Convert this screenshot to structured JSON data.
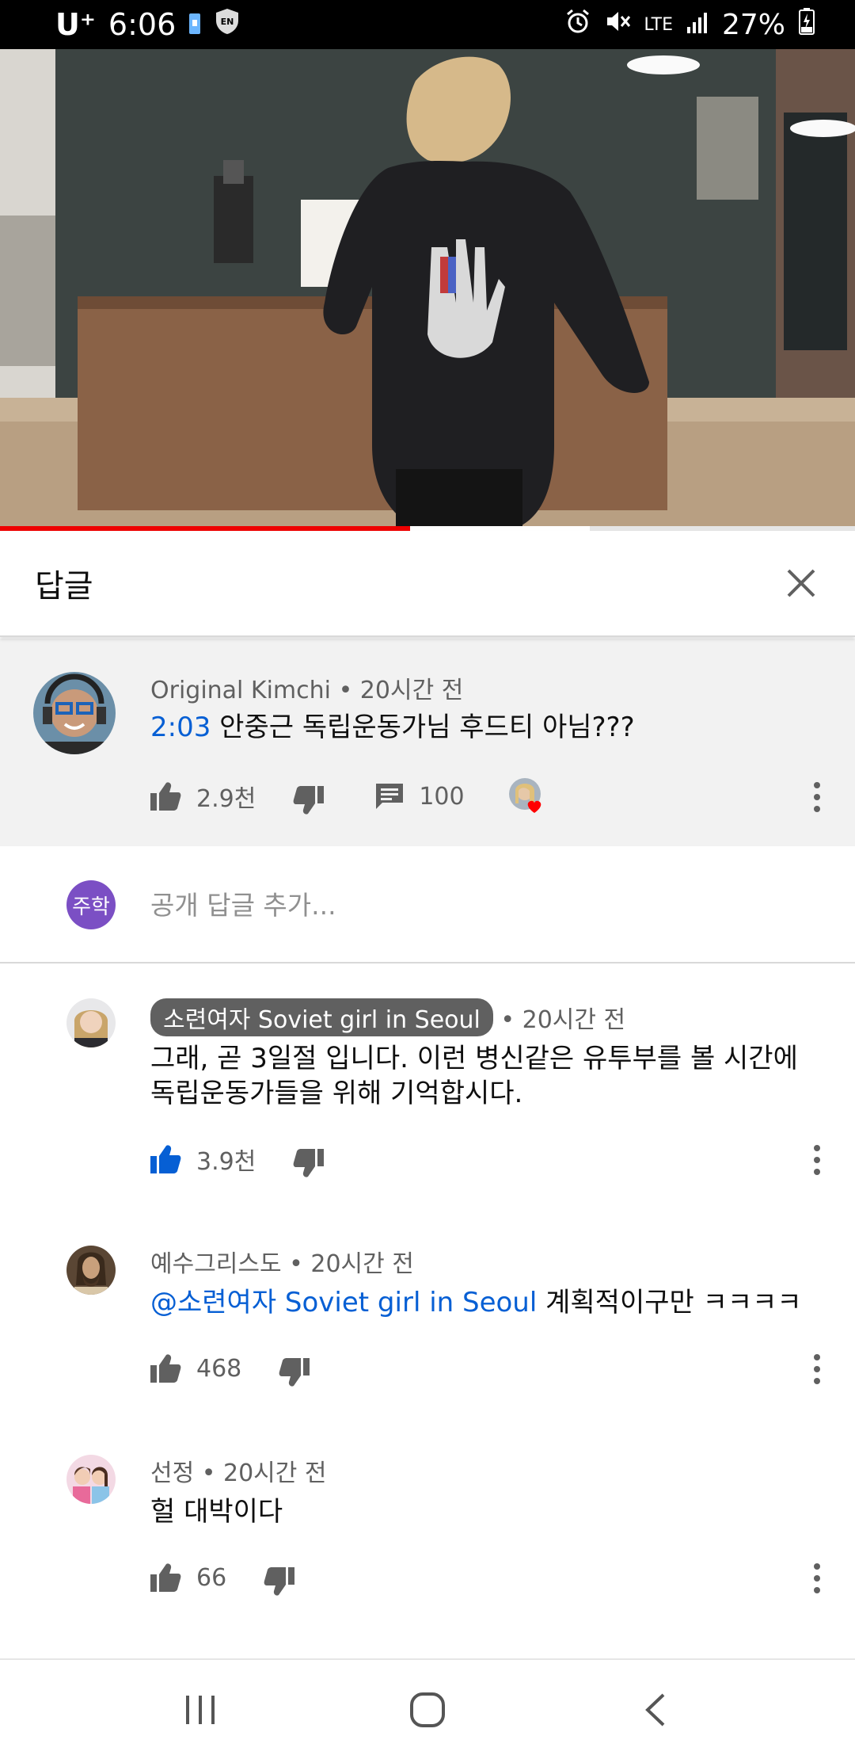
{
  "status_bar": {
    "carrier": "U⁺",
    "time": "6:06",
    "network": "LTE",
    "battery": "27%"
  },
  "video": {
    "progress": 0.48,
    "buffered": 0.69
  },
  "replies_panel": {
    "title": "답글"
  },
  "parent_comment": {
    "author": "Original Kimchi",
    "time": "• 20시간 전",
    "timestamp_link": "2:03",
    "text": " 안중근 독립운동가님 후드티 아님???",
    "likes": "2.9천",
    "replies": "100"
  },
  "add_reply": {
    "avatar_initials": "주학",
    "placeholder": "공개 답글 추가..."
  },
  "replies": [
    {
      "author": "소련여자 Soviet girl in Seoul",
      "time": "• 20시간 전",
      "text": "그래, 곧 3일절 입니다. 이런 병신같은 유투부를 볼 시간에 독립운동가들을 위해 기억합시다.",
      "likes": "3.9천",
      "liked": true
    },
    {
      "author": "예수그리스도",
      "time": "• 20시간 전",
      "mention": "@소련여자 Soviet girl in Seoul",
      "text": " 계획적이구만 ㅋㅋㅋㅋ",
      "likes": "468",
      "liked": false
    },
    {
      "author": "선정",
      "time": "• 20시간 전",
      "text": "헐 대박이다",
      "likes": "66",
      "liked": false
    }
  ],
  "colors": {
    "link": "#065fd4",
    "like_active": "#065fd4",
    "progress": "#ee0000",
    "heart": "#ff0000"
  },
  "icons": [
    "alarm-icon",
    "mute-icon",
    "signal-icon",
    "battery-charging-icon",
    "close-icon",
    "thumbs-up-icon",
    "thumbs-down-icon",
    "reply-icon",
    "heart-icon",
    "more-vertical-icon",
    "recents-icon",
    "home-icon",
    "back-icon"
  ]
}
